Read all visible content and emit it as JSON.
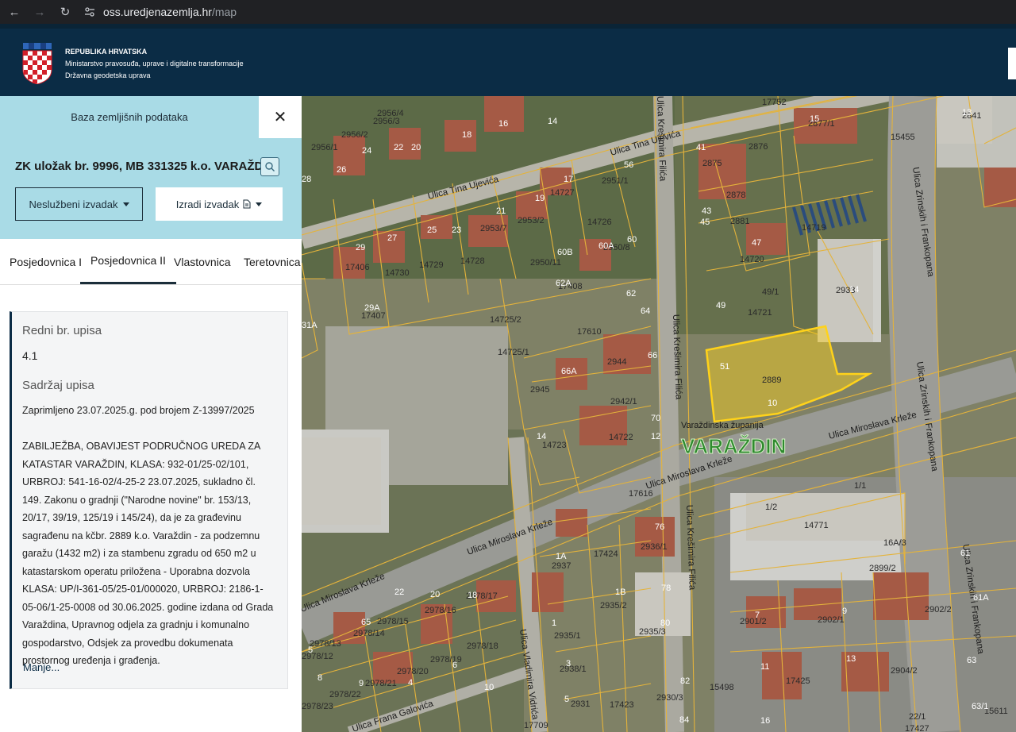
{
  "browser": {
    "back_icon": "←",
    "forward_icon": "→",
    "reload_icon": "↻",
    "url_host": "oss.uredjenazemlja.hr",
    "url_path": "/map"
  },
  "header": {
    "line1": "REPUBLIKA HRVATSKA",
    "line2": "Ministarstvo pravosuđa, uprave i digitalne transformacije",
    "line3": "Državna geodetska uprava"
  },
  "panel": {
    "title": "Baza zemljišnih podataka",
    "close_icon": "✕",
    "zk_title": "ZK uložak br. 9996, MB 331325 k.o. VARAŽDIN",
    "btn_nesluzbeni": "Neslužbeni izvadak",
    "btn_izradi": "Izradi izvadak",
    "tabs": [
      "Posjedovnica I",
      "Posjedovnica II",
      "Vlastovnica",
      "Teretovnica"
    ],
    "active_tab": 1,
    "entry": {
      "redni_label": "Redni br. upisa",
      "redni_value": "4.1",
      "sadrzaj_label": "Sadržaj upisa",
      "zaprimljeno": "Zaprimljeno 23.07.2025.g. pod brojem Z-13997/2025",
      "text": "ZABILJEŽBA, OBAVIJEST PODRUČNOG UREDA ZA KATASTAR VARAŽDIN, KLASA: 932-01/25-02/101, URBROJ: 541-16-02/4-25-2 23.07.2025, sukladno čl. 149. Zakonu o gradnji (\"Narodne novine\" br. 153/13, 20/17, 39/19, 125/19 i 145/24), da je za građevinu sagrađenu na kčbr. 2889 k.o. Varaždin - za podzemnu garažu (1432 m2) i za stambenu zgradu od 650 m2 u katastarskom operatu priložena - Uporabna dozvola KLASA: UP/I-361-05/25-01/000020, URBROJ: 2186-1-05-06/1-25-0008 od 30.06.2025. godine izdana od Grada Varaždina, Upravnog odjela za gradnju i komunalno gospodarstvo, Odsjek za provedbu dokumenata prostornog uređenja i građenja.",
      "less_link": "Manje..."
    }
  },
  "map": {
    "city_label": "VARAŽDIN",
    "county_label": "Varaždinska županija",
    "highlight_color": "#ffd21a",
    "streets": [
      "Ulica Tina Ujevića",
      "Ulica Tina Ujevića",
      "Ulica Krešimira Filića",
      "Ulica Krešimira Filića",
      "Ulica Krešimira Filića",
      "Ulica Miroslava Krleže",
      "Ulica Miroslava Krleže",
      "Ulica Miroslava Krleže",
      "Ulica Miroslava Krleže",
      "Ulica Zrinskih i Frankopana",
      "Ulica Zrinskih i Frankopana",
      "Ulica Zrinskih i Frankopana",
      "Ulica Vladimira Vidrića",
      "Ulica Frana Galovića"
    ],
    "plots": [
      "2956/4",
      "2956/3",
      "2956/2",
      "2956/1",
      "17752",
      "2877/1",
      "15455",
      "2876",
      "2875",
      "2878",
      "2881",
      "14719",
      "14720",
      "14721",
      "49/1",
      "2951/1",
      "14727",
      "2953/2",
      "2953/7",
      "14726",
      "14728",
      "14729",
      "14730",
      "17406",
      "17407",
      "2950/11",
      "2960/8",
      "14725/2",
      "14725/1",
      "17610",
      "2944",
      "2945",
      "2942/1",
      "14722",
      "14723",
      "2889",
      "17616",
      "14771",
      "1/1",
      "1/2",
      "2936/1",
      "17424",
      "2937",
      "2935/2",
      "2935/1",
      "2935/3",
      "2938/1",
      "2931",
      "17423",
      "2930/3",
      "15498",
      "2901/2",
      "2902/1",
      "17425",
      "2904/2",
      "2899/2",
      "2902/2",
      "16A/3",
      "22/1",
      "15611",
      "2978/16",
      "2978/15",
      "2978/14",
      "2978/13",
      "2978/18",
      "2978/19",
      "2978/20",
      "2978/21",
      "2978/22",
      "2978/23",
      "2978/12",
      "2978/17",
      "17408",
      "17709",
      "17427",
      "2841",
      "2933"
    ],
    "housenumbers": [
      "14",
      "16",
      "18",
      "20",
      "22",
      "24",
      "26",
      "28",
      "41",
      "43",
      "45",
      "15",
      "13",
      "56",
      "17",
      "19",
      "21",
      "23",
      "25",
      "27",
      "29",
      "29A",
      "31A",
      "60B",
      "60A",
      "60",
      "62A",
      "62",
      "64",
      "66",
      "66A",
      "70",
      "12",
      "14",
      "47",
      "49",
      "51",
      "10",
      "14",
      "76",
      "78",
      "80",
      "82",
      "84",
      "1A",
      "1B",
      "1",
      "3",
      "5",
      "7",
      "9",
      "11",
      "13",
      "61",
      "61A",
      "63",
      "63/1",
      "16",
      "18",
      "20",
      "22",
      "65",
      "5",
      "8",
      "9",
      "4",
      "6",
      "10"
    ]
  }
}
